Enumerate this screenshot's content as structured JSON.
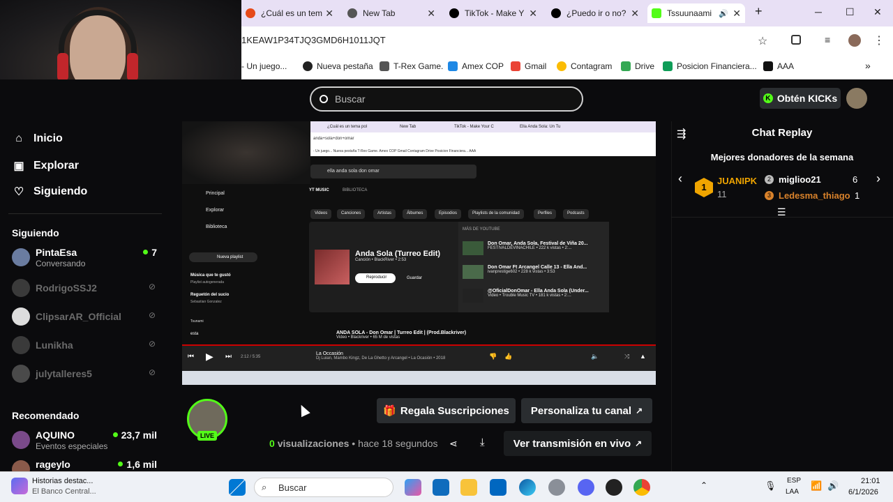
{
  "browser": {
    "tabs": [
      {
        "label": "¿Cuál es un tem",
        "color": "#e64a19"
      },
      {
        "label": "New Tab",
        "color": "#555555"
      },
      {
        "label": "TikTok - Make Y",
        "color": "#000000"
      },
      {
        "label": "¿Puedo ir o no?",
        "color": "#000000"
      },
      {
        "label": "Tssuunaami",
        "color": "#53fc18"
      }
    ],
    "new_tab": "+",
    "url": "1KEAW1P34TJQ3GMD6H1011JQT",
    "bookmarks": [
      "- Un juego...",
      "Nueva pestaña",
      "T-Rex Game.",
      "Amex COP",
      "Gmail",
      "Contagram",
      "Drive",
      "Posicion Financiera...",
      "AAA"
    ]
  },
  "header": {
    "search_placeholder": "Buscar",
    "kicks_label": "Obtén KICKs"
  },
  "sidebar": {
    "nav": [
      {
        "label": "Inicio",
        "icon": "home-icon"
      },
      {
        "label": "Explorar",
        "icon": "explore-icon"
      },
      {
        "label": "Siguiendo",
        "icon": "heart-icon"
      }
    ],
    "following_title": "Siguiendo",
    "following": [
      {
        "name": "PintaEsa",
        "sub": "Conversando",
        "count": "7",
        "online": true
      },
      {
        "name": "RodrigoSSJ2",
        "online": false
      },
      {
        "name": "ClipsarAR_Official",
        "online": false
      },
      {
        "name": "Lunikha",
        "online": false
      },
      {
        "name": "julytalleres5",
        "online": false
      }
    ],
    "recommended_title": "Recomendado",
    "recommended": [
      {
        "name": "AQUINO",
        "sub": "Eventos especiales",
        "count": "23,7 mil"
      },
      {
        "name": "rageylo",
        "count": "1,6 mil"
      }
    ]
  },
  "video": {
    "mini_tabs": [
      "¿Cuál es un tema pol",
      "New Tab",
      "TikTok - Make Your C",
      "Ella Anda Sola: Un Tu"
    ],
    "mini_url": "anda+sola+don+omar",
    "mini_bookmarks": "- Un juego...   Nueva pestaña   T-Rex Game.   Amex COP   Gmail   Contagram   Drive   Posicion Financiera...   AAA",
    "ytm_search": "ella anda sola don omar",
    "ytm_tabs": [
      "YT MUSIC",
      "BIBLIOTECA"
    ],
    "ytm_nav": [
      "Principal",
      "Explorar",
      "Biblioteca"
    ],
    "new_playlist": "Nueva playlist",
    "playlists": [
      {
        "title": "Música que te gustó",
        "sub": "Playlist autogenerada"
      },
      {
        "title": "Reguetón del sucio",
        "sub": "Sebastian Gonzalez"
      },
      {
        "title": "Tsunami",
        "sub": ""
      },
      {
        "title": "esta",
        "sub": ""
      }
    ],
    "filters": [
      "Videos",
      "Canciones",
      "Artistas",
      "Álbumes",
      "Episodios",
      "Playlists de la comunidad",
      "Perfiles",
      "Podcasts"
    ],
    "top_song": {
      "title": "Anda Sola (Turreo Edit)",
      "sub": "Canción • BlackRiver • 2:53",
      "play": "Reproducir",
      "save": "Guardar"
    },
    "more_title": "MÁS DE YOUTUBE",
    "more": [
      {
        "title": "Don Omar, Anda Sola, Festival de Viña 20...",
        "sub": "FESTIVALDEVINACHILE • 222 k vistas • 2:..."
      },
      {
        "title": "Don Omar Ft Arcangel Calle 13 - Ella And...",
        "sub": "ivanprestige602 • 228 k vistas • 3:53"
      },
      {
        "title": "@OficialDonOmar - Ella Anda Sola (Under...",
        "sub": "Video • Trouble Music TV • 181 k vistas • 2:..."
      }
    ],
    "result": {
      "title": "ANDA SOLA - Don Omar | Turreo Edit | (Prod.Blackriver)",
      "sub": "Video • Blackriver • 65 M de vistas"
    },
    "now_playing": {
      "title": "La Occasión",
      "sub": "Dj Luian, Mambo Kingz, De La Ghetto y Arcangel • La Ocasión • 2018",
      "time": "2:12 / 5:35",
      "progress": 0.4
    }
  },
  "stream": {
    "live_label": "LIVE",
    "gift_button": "Regala Suscripciones",
    "customize_button": "Personaliza tu canal",
    "views_count": "0",
    "views_label": "visualizaciones",
    "time_ago": "• hace 18 segundos",
    "watch_live": "Ver transmisión en vivo"
  },
  "chat": {
    "title": "Chat Replay",
    "donors_title": "Mejores donadores de la semana",
    "top_donor": {
      "name": "JUANIPK",
      "count": "11",
      "rank": "1"
    },
    "donors": [
      {
        "name": "miglioo21",
        "count": "6",
        "rank": "2"
      },
      {
        "name": "Ledesma_thiago",
        "count": "1",
        "rank": "3"
      }
    ]
  },
  "taskbar": {
    "news_title": "Historias destac...",
    "news_sub": "El Banco Central...",
    "search": "Buscar",
    "lang": "ESP",
    "lang_sub": "LAA",
    "time": "21:01",
    "date": "6/1/2026"
  },
  "colors": {
    "accent": "#53fc18",
    "bg": "#0b0b0d",
    "panel": "#2a2d30"
  }
}
